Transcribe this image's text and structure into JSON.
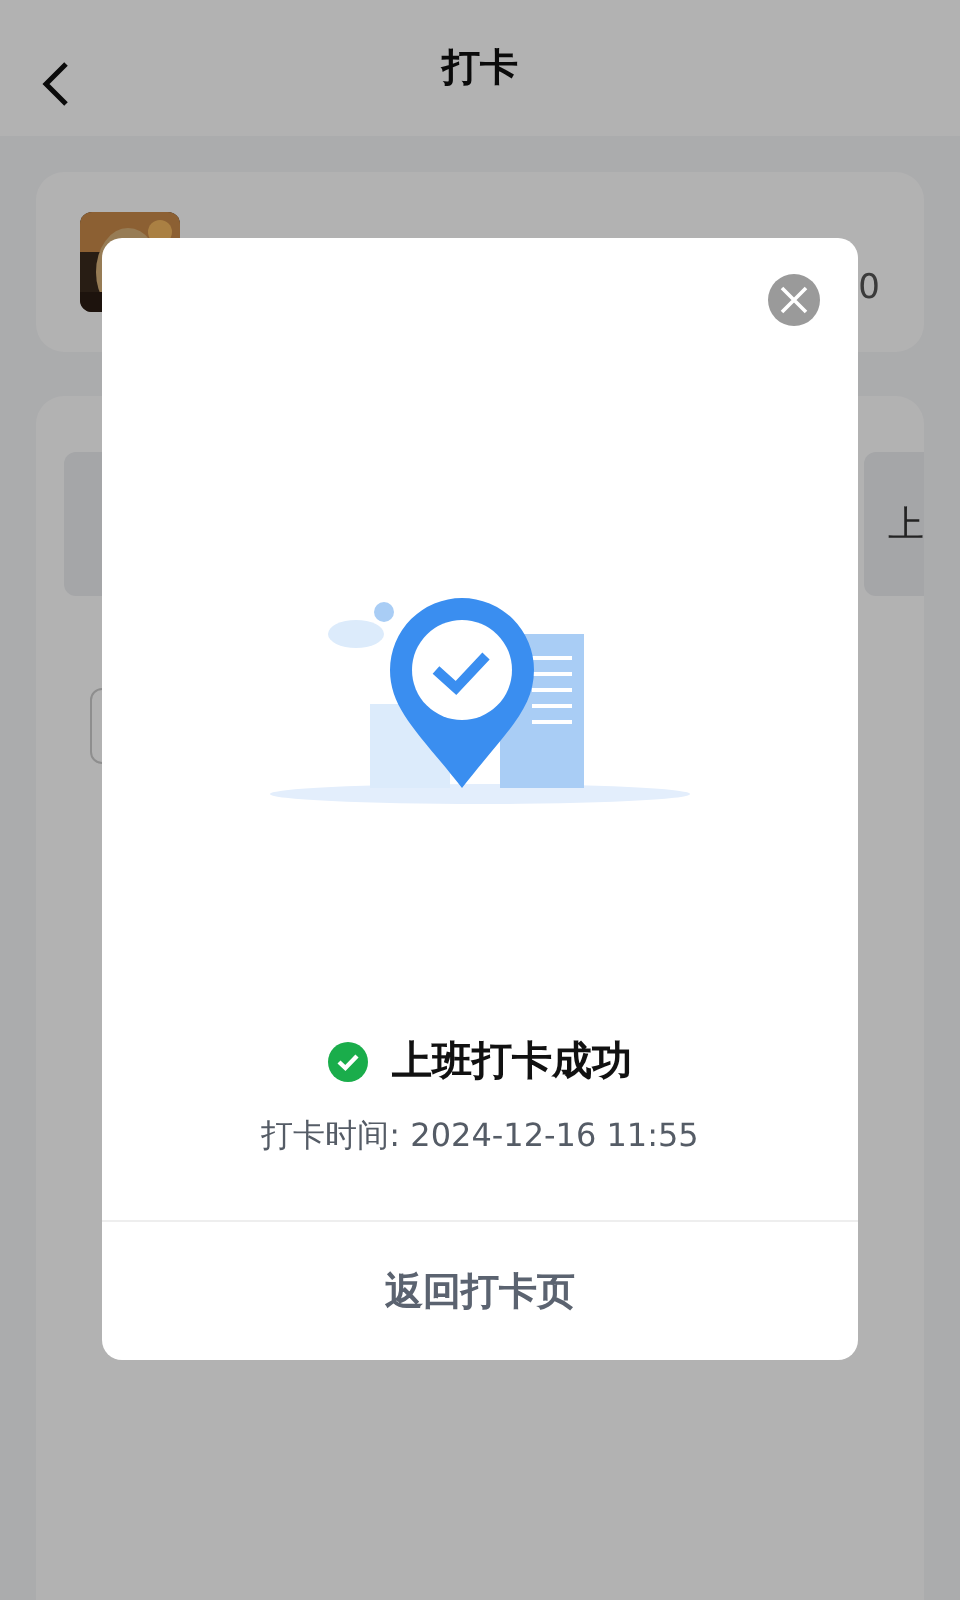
{
  "header": {
    "title": "打卡"
  },
  "profile": {
    "side_text": "0"
  },
  "punch": {
    "right_tile": "上"
  },
  "dialog": {
    "status": "上班打卡成功",
    "time": "打卡时间: 2024-12-16 11:55",
    "action": "返回打卡页"
  }
}
